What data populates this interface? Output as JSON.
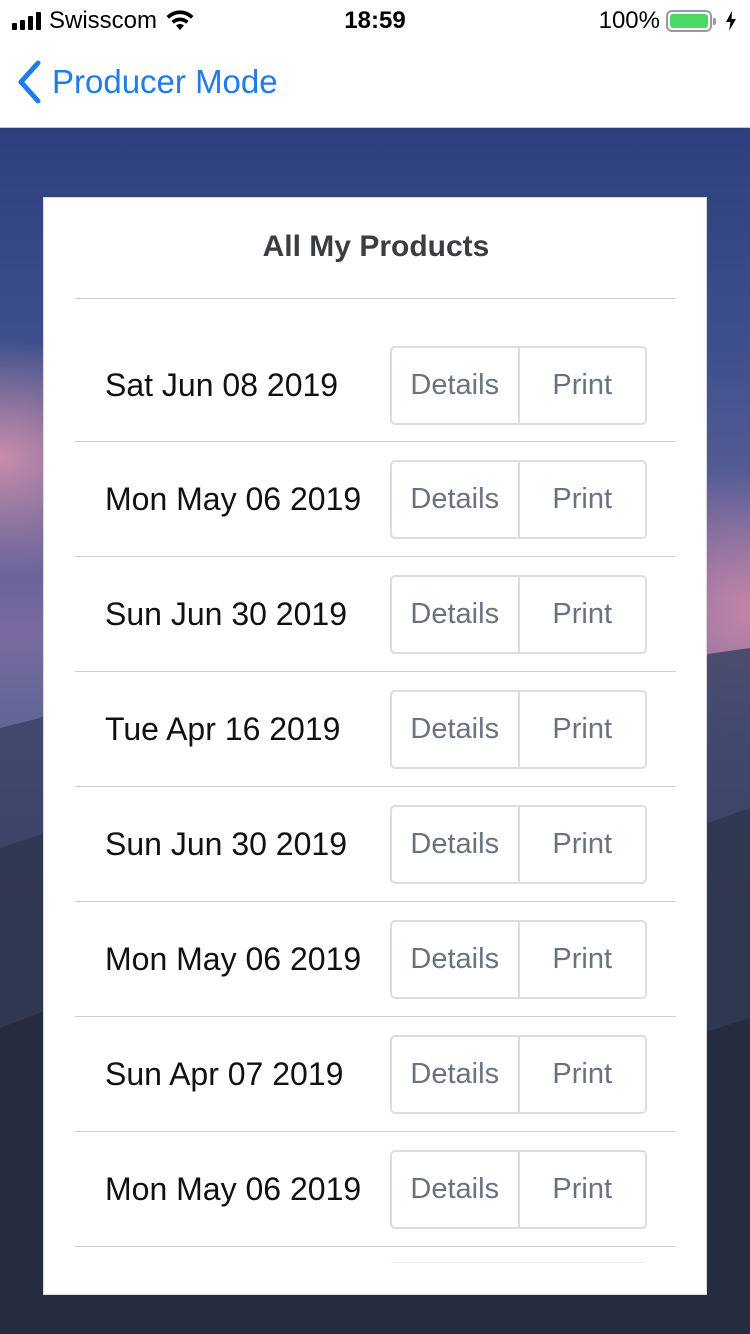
{
  "status_bar": {
    "carrier": "Swisscom",
    "time": "18:59",
    "battery_percent": "100%",
    "battery_level": 1.0,
    "battery_color": "#4cd964"
  },
  "nav": {
    "back_label": "Producer Mode",
    "accent_color": "#1f7ce8"
  },
  "card": {
    "title": "All My Products",
    "rows": [
      {
        "date": "Sat Jun 08 2019",
        "details_label": "Details",
        "print_label": "Print"
      },
      {
        "date": "Mon May 06 2019",
        "details_label": "Details",
        "print_label": "Print"
      },
      {
        "date": "Sun Jun 30 2019",
        "details_label": "Details",
        "print_label": "Print"
      },
      {
        "date": "Tue Apr 16 2019",
        "details_label": "Details",
        "print_label": "Print"
      },
      {
        "date": "Sun Jun 30 2019",
        "details_label": "Details",
        "print_label": "Print"
      },
      {
        "date": "Mon May 06 2019",
        "details_label": "Details",
        "print_label": "Print"
      },
      {
        "date": "Sun Apr 07 2019",
        "details_label": "Details",
        "print_label": "Print"
      },
      {
        "date": "Mon May 06 2019",
        "details_label": "Details",
        "print_label": "Print"
      }
    ]
  }
}
